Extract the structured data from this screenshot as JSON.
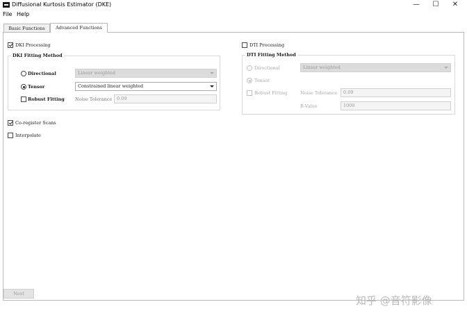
{
  "window": {
    "title": "Diffusional Kurtosis Estimator (DKE)",
    "minimize_glyph": "—",
    "maximize_glyph": "☐",
    "close_glyph": "✕"
  },
  "menu": {
    "items": [
      "File",
      "Help"
    ]
  },
  "tabs": [
    {
      "label": "Basic Functions",
      "active": false
    },
    {
      "label": "Advanced Functions",
      "active": true
    }
  ],
  "dki": {
    "processing_label": "DKI Processing",
    "processing_checked": true,
    "group_title": "DKI Fitting Method",
    "directional_label": "Directional",
    "directional_value": "Linear weighted",
    "tensor_label": "Tensor",
    "tensor_value": "Constrained linear weighted",
    "selected_method": "Tensor",
    "robust_label": "Robust Fitting",
    "robust_checked": false,
    "noise_label": "Noise Tolerance",
    "noise_value": "0.09"
  },
  "dti": {
    "processing_label": "DTI Processing",
    "processing_checked": false,
    "group_title": "DTI Fitting Method",
    "directional_label": "Directional",
    "directional_value": "Linear weighted",
    "tensor_label": "Tensor",
    "selected_method": "Tensor",
    "robust_label": "Robust Fitting",
    "robust_checked": false,
    "noise_label": "Noise Tolerance",
    "noise_value": "0.09",
    "bvalue_label": "B-Value",
    "bvalue_value": "1000"
  },
  "options": {
    "coregister_label": "Co-register Scans",
    "coregister_checked": true,
    "interpolate_label": "Interpolate",
    "interpolate_checked": false
  },
  "footer": {
    "next_label": "Next"
  },
  "watermark": "知乎 @音符影像"
}
